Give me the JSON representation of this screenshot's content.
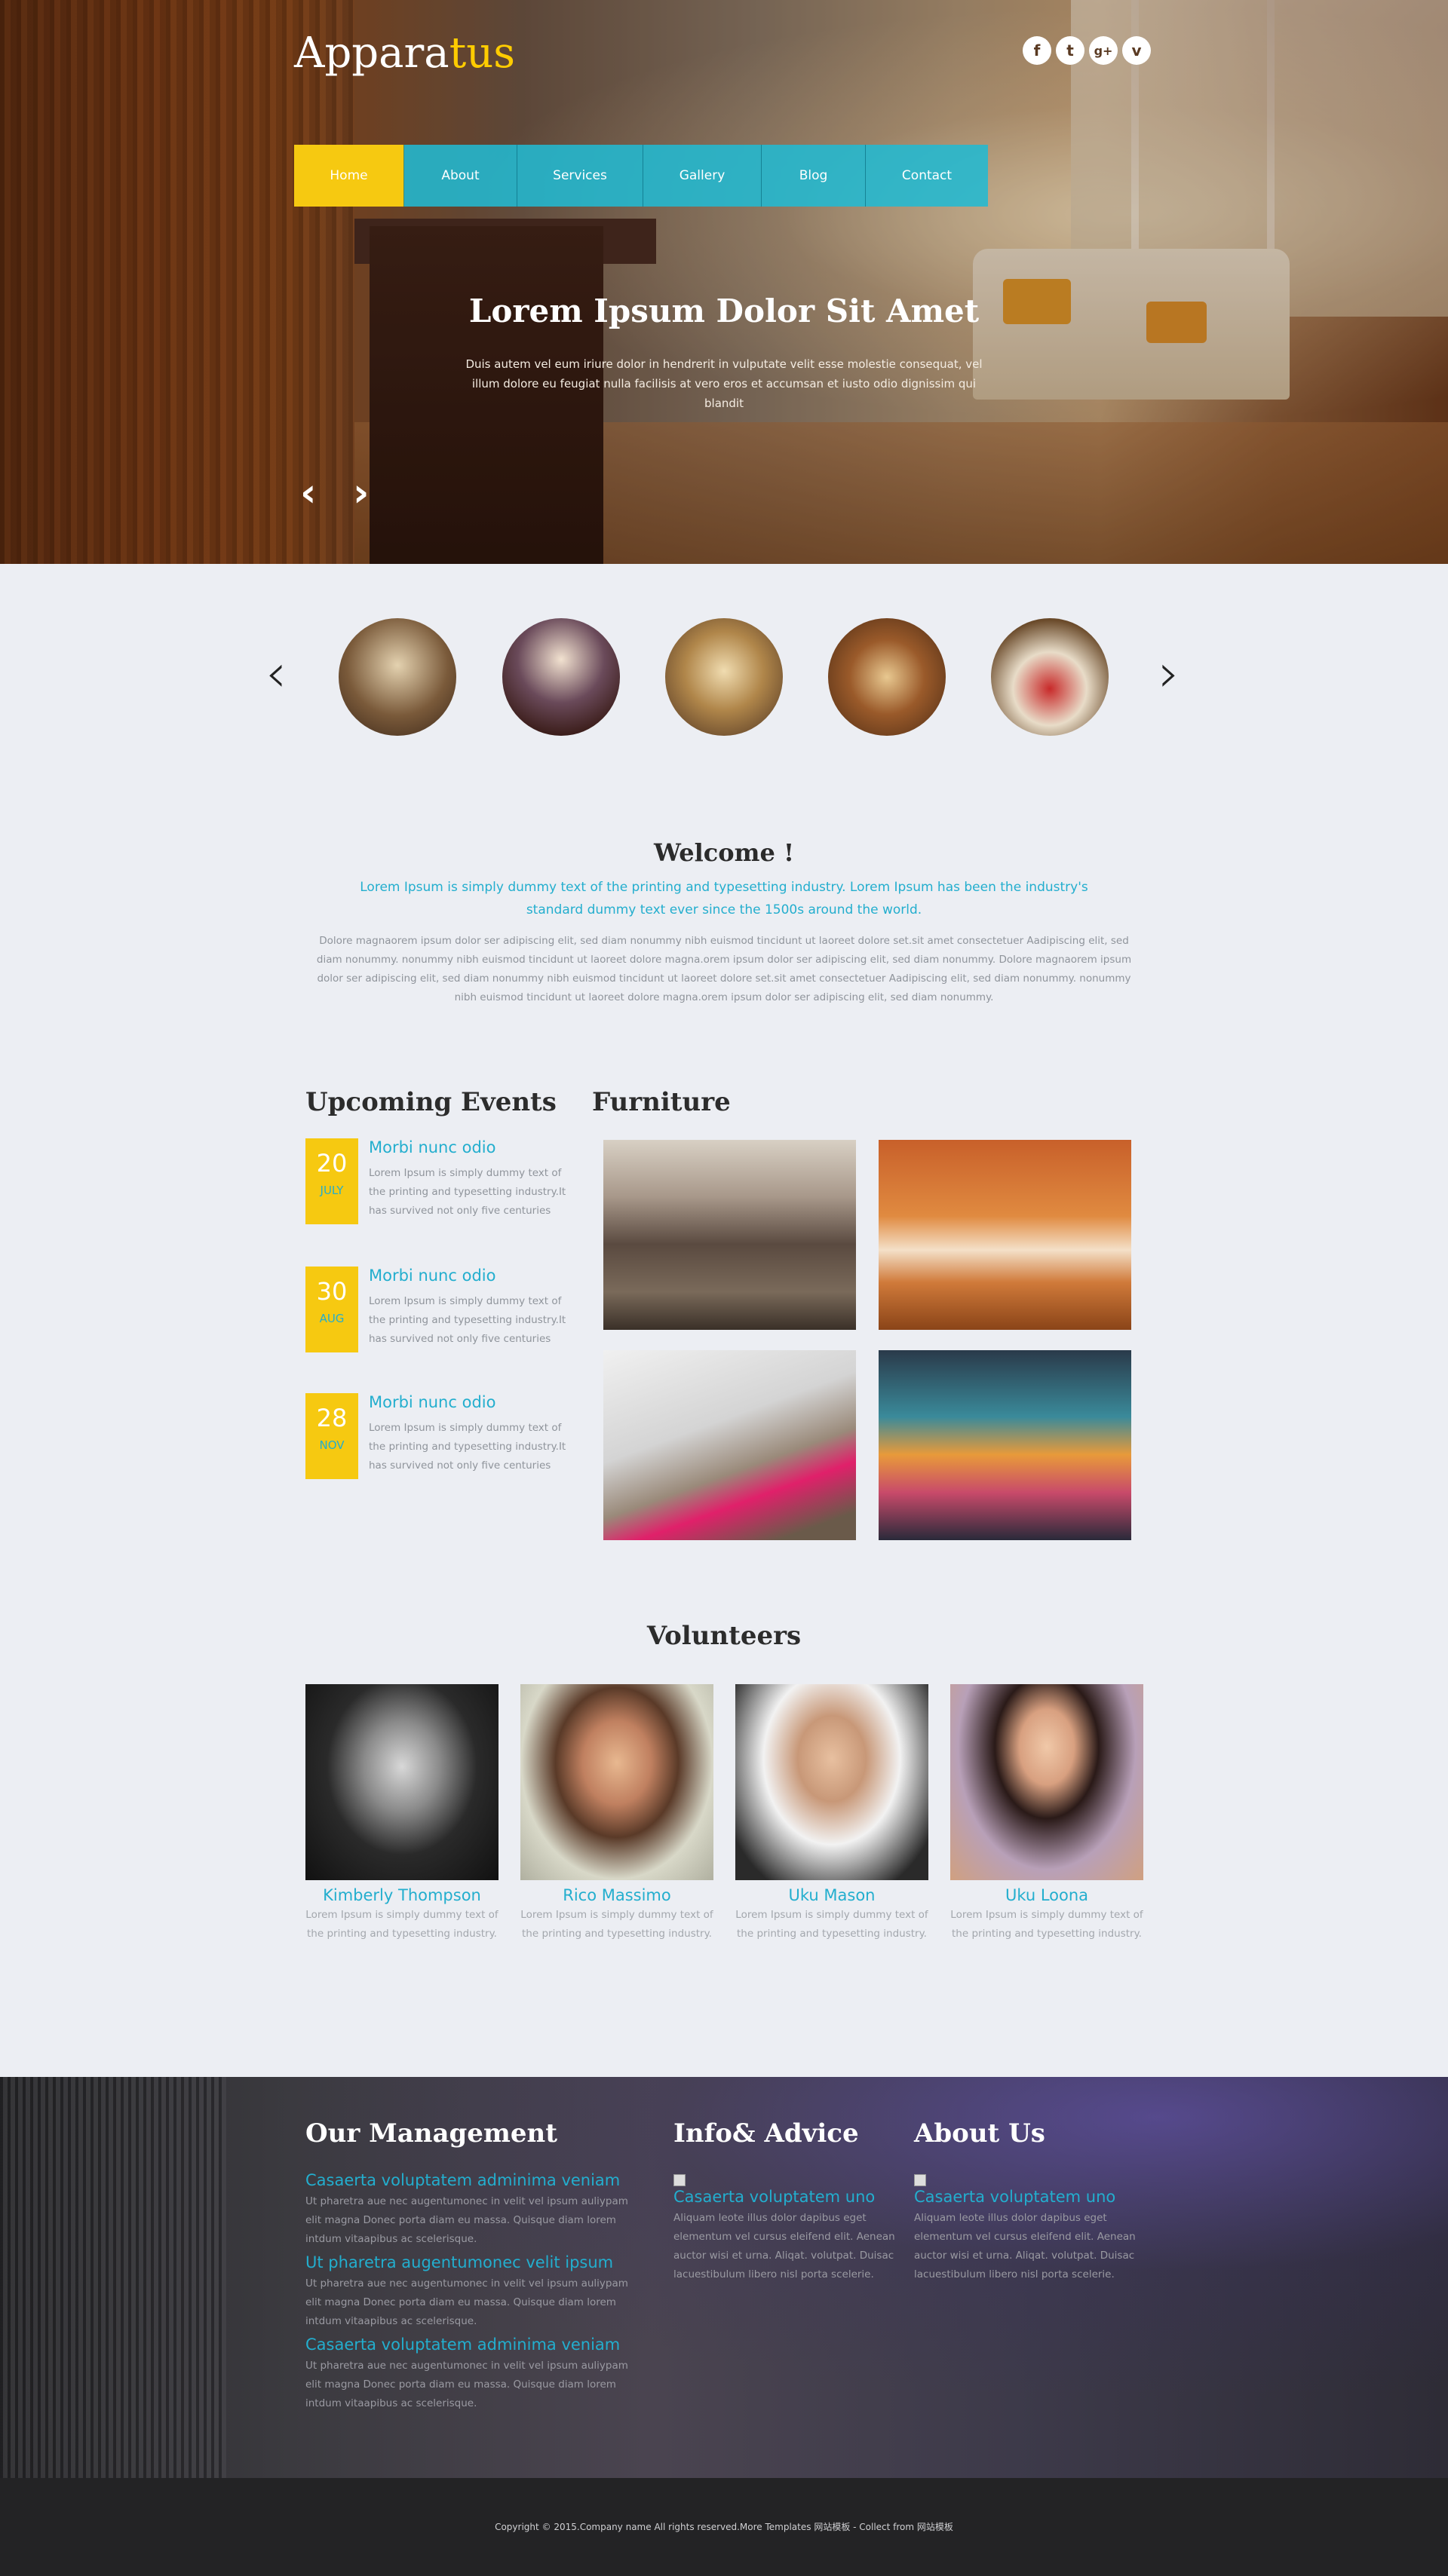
{
  "brand": {
    "logo_main": "Appara",
    "logo_accent": "tus"
  },
  "social": [
    {
      "icon": "facebook-icon",
      "glyph": "f"
    },
    {
      "icon": "twitter-icon",
      "glyph": "t"
    },
    {
      "icon": "google-plus-icon",
      "glyph": "g+"
    },
    {
      "icon": "vimeo-icon",
      "glyph": "v"
    }
  ],
  "nav": [
    "Home",
    "About",
    "Services",
    "Gallery",
    "Blog",
    "Contact"
  ],
  "hero": {
    "title": "Lorem Ipsum Dolor Sit Amet",
    "text": "Duis autem vel eum iriure dolor in hendrerit in vulputate velit esse molestie consequat, vel illum dolore eu feugiat nulla facilisis at vero eros et accumsan et iusto odio dignissim qui blandit",
    "prev": "‹",
    "next": "›"
  },
  "carousel": {
    "prev": "‹",
    "next": "›"
  },
  "welcome": {
    "title": "Welcome !",
    "lead": "Lorem Ipsum is simply dummy text of the printing and typesetting industry. Lorem Ipsum has been the industry's standard dummy text ever since the 1500s around the world.",
    "body": "Dolore magnaorem ipsum dolor ser adipiscing elit, sed diam nonummy nibh euismod tincidunt ut laoreet dolore set.sit amet consectetuer Aadipiscing elit, sed diam nonummy. nonummy nibh euismod tincidunt ut laoreet dolore magna.orem ipsum dolor ser adipiscing elit, sed diam nonummy. Dolore magnaorem ipsum dolor ser adipiscing elit, sed diam nonummy nibh euismod tincidunt ut laoreet dolore set.sit amet consectetuer Aadipiscing elit, sed diam nonummy. nonummy nibh euismod tincidunt ut laoreet dolore magna.orem ipsum dolor ser adipiscing elit, sed diam nonummy."
  },
  "events": {
    "title": "Upcoming Events",
    "items": [
      {
        "day": "20",
        "month": "JULY",
        "title": "Morbi nunc odio",
        "text": "Lorem Ipsum is simply dummy text of the printing and typesetting industry.It has survived not only five centuries"
      },
      {
        "day": "30",
        "month": "AUG",
        "title": "Morbi nunc odio",
        "text": "Lorem Ipsum is simply dummy text of the printing and typesetting industry.It has survived not only five centuries"
      },
      {
        "day": "28",
        "month": "NOV",
        "title": "Morbi nunc odio",
        "text": "Lorem Ipsum is simply dummy text of the printing and typesetting industry.It has survived not only five centuries"
      }
    ]
  },
  "furniture": {
    "title": "Furniture"
  },
  "volunteers": {
    "title": "Volunteers",
    "items": [
      {
        "name": "Kimberly Thompson",
        "text": "Lorem Ipsum is simply dummy text of the printing and typesetting industry."
      },
      {
        "name": "Rico Massimo",
        "text": "Lorem Ipsum is simply dummy text of the printing and typesetting industry."
      },
      {
        "name": "Uku Mason",
        "text": "Lorem Ipsum is simply dummy text of the printing and typesetting industry."
      },
      {
        "name": "Uku Loona",
        "text": "Lorem Ipsum is simply dummy text of the printing and typesetting industry."
      }
    ]
  },
  "footer": {
    "management": {
      "title": "Our Management",
      "items": [
        {
          "link": "Casaerta voluptatem adminima veniam",
          "text": "Ut pharetra aue nec augentumonec in velit vel ipsum auliypam elit magna Donec porta diam eu massa. Quisque diam lorem intdum vitaapibus ac scelerisque."
        },
        {
          "link": "Ut pharetra augentumonec velit ipsum",
          "text": "Ut pharetra aue nec augentumonec in velit vel ipsum auliypam elit magna Donec porta diam eu massa. Quisque diam lorem intdum vitaapibus ac scelerisque."
        },
        {
          "link": "Casaerta voluptatem adminima veniam",
          "text": "Ut pharetra aue nec augentumonec in velit vel ipsum auliypam elit magna Donec porta diam eu massa. Quisque diam lorem intdum vitaapibus ac scelerisque."
        }
      ]
    },
    "info": {
      "title": "Info& Advice",
      "link": "Casaerta voluptatem uno",
      "text": "Aliquam leote illus dolor dapibus eget elementum vel cursus eleifend elit. Aenean auctor wisi et urna. Aliqat. volutpat. Duisac lacuestibulum libero nisl porta scelerie."
    },
    "about": {
      "title": "About Us",
      "link": "Casaerta voluptatem uno",
      "text": "Aliquam leote illus dolor dapibus eget elementum vel cursus eleifend elit. Aenean auctor wisi et urna. Aliqat. volutpat. Duisac lacuestibulum libero nisl porta scelerie."
    }
  },
  "copyright": "Copyright © 2015.Company name All rights reserved.More Templates  网站模板  - Collect from  网站模板",
  "colors": {
    "accent": "#23aece",
    "yellow": "#f6c911",
    "nav_blue": "#22bad2"
  }
}
